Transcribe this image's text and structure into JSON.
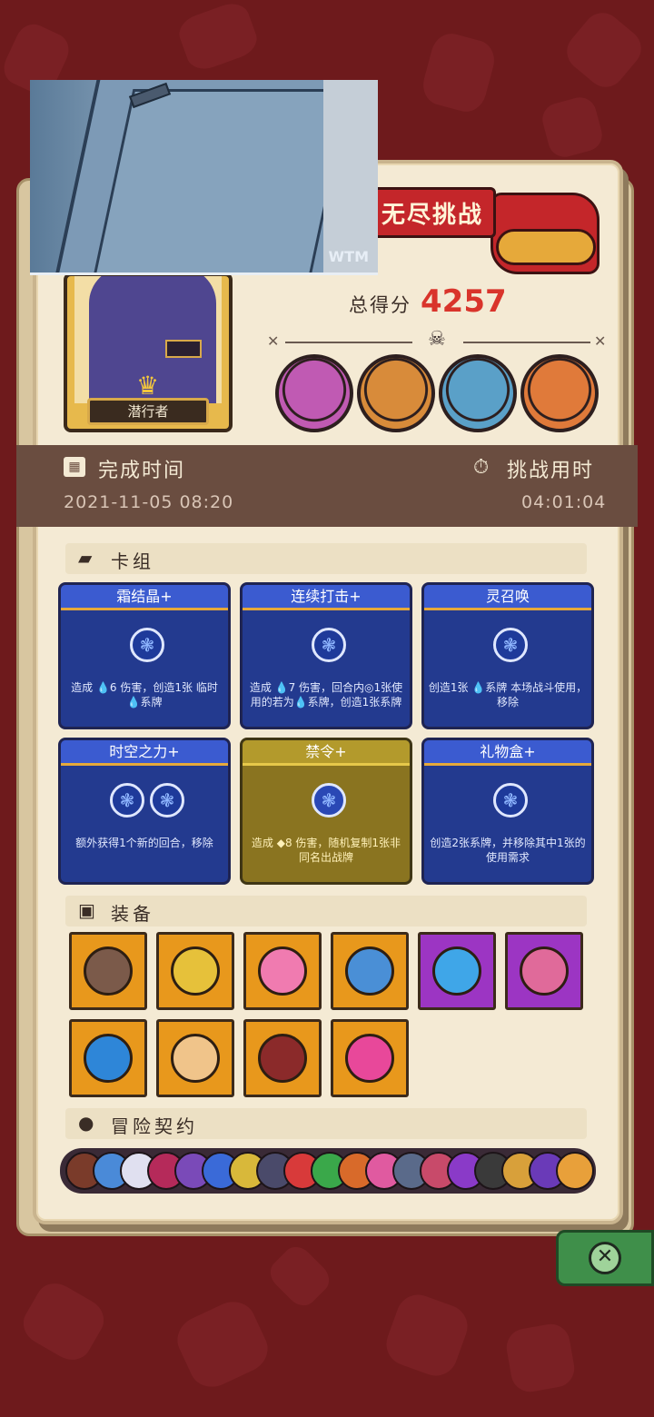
{
  "challenge": {
    "title": "无尽挑战",
    "score_label": "总得分",
    "score_value": "4257"
  },
  "video": {
    "watermark": "WTM"
  },
  "character": {
    "name": "潜行者"
  },
  "bosses": [
    {
      "name": "boss-pink-demon",
      "color": "#c05ab3"
    },
    {
      "name": "boss-warrior",
      "color": "#d88b3a"
    },
    {
      "name": "boss-blue-beast",
      "color": "#5aa0c8"
    },
    {
      "name": "boss-tribal-mask",
      "color": "#e07a3a"
    }
  ],
  "time": {
    "complete_label": "完成时间",
    "complete_value": "2021-11-05 08:20",
    "duration_label": "挑战用时",
    "duration_value": "04:01:04"
  },
  "sections": {
    "deck": "卡组",
    "equipment": "装备",
    "contract": "冒险契约"
  },
  "cards": [
    {
      "title": "霜结晶+",
      "desc": "造成 💧6 伤害，创造1张 临时💧系牌",
      "runes": 1,
      "style": "blue"
    },
    {
      "title": "连续打击+",
      "desc": "造成 💧7 伤害，回合内◎1张使用的若为💧系牌，创造1张系牌",
      "runes": 1,
      "style": "blue"
    },
    {
      "title": "灵召唤",
      "desc": "创造1张 💧系牌 本场战斗使用，移除",
      "runes": 1,
      "style": "blue"
    },
    {
      "title": "时空之力+",
      "desc": "额外获得1个新的回合，移除",
      "runes": 2,
      "style": "blue"
    },
    {
      "title": "禁令+",
      "desc": "造成 ◆8 伤害，随机复制1张非同名出战牌",
      "runes": 1,
      "style": "gold"
    },
    {
      "title": "礼物盒+",
      "desc": "创造2张系牌，并移除其中1张的使用需求",
      "runes": 1,
      "style": "blue"
    }
  ],
  "equipment": [
    {
      "name": "bronze-shield-item",
      "color": "#7b5a4a",
      "bg": "orange"
    },
    {
      "name": "gold-coin-item",
      "color": "#e6c13a",
      "bg": "orange"
    },
    {
      "name": "heart-box-item",
      "color": "#f07bb0",
      "bg": "orange"
    },
    {
      "name": "mushroom-item",
      "color": "#4a8fd6",
      "bg": "orange"
    },
    {
      "name": "water-drop-item",
      "color": "#3fa6e8",
      "bg": "purple"
    },
    {
      "name": "pink-shell-item",
      "color": "#e06a9a",
      "bg": "purple"
    },
    {
      "name": "blue-orb-key-item",
      "color": "#2e86d8",
      "bg": "orange"
    },
    {
      "name": "ring-item",
      "color": "#f0c48a",
      "bg": "orange"
    },
    {
      "name": "spiked-collar-item",
      "color": "#8b2a2a",
      "bg": "orange"
    },
    {
      "name": "pink-flame-item",
      "color": "#e8489a",
      "bg": "orange"
    }
  ],
  "contracts": [
    "#7a3b2a",
    "#4a8ad8",
    "#e0e0f0",
    "#b52a5a",
    "#7a4ab8",
    "#3a6ad8",
    "#d8b83a",
    "#4a4a6a",
    "#d83a3a",
    "#3aa84a",
    "#d86a2a",
    "#e05aa0",
    "#5a6a8a",
    "#c84a6a",
    "#8a3ac8",
    "#3a3a3a",
    "#d8a03a",
    "#6a3ab8",
    "#e8a03a"
  ]
}
